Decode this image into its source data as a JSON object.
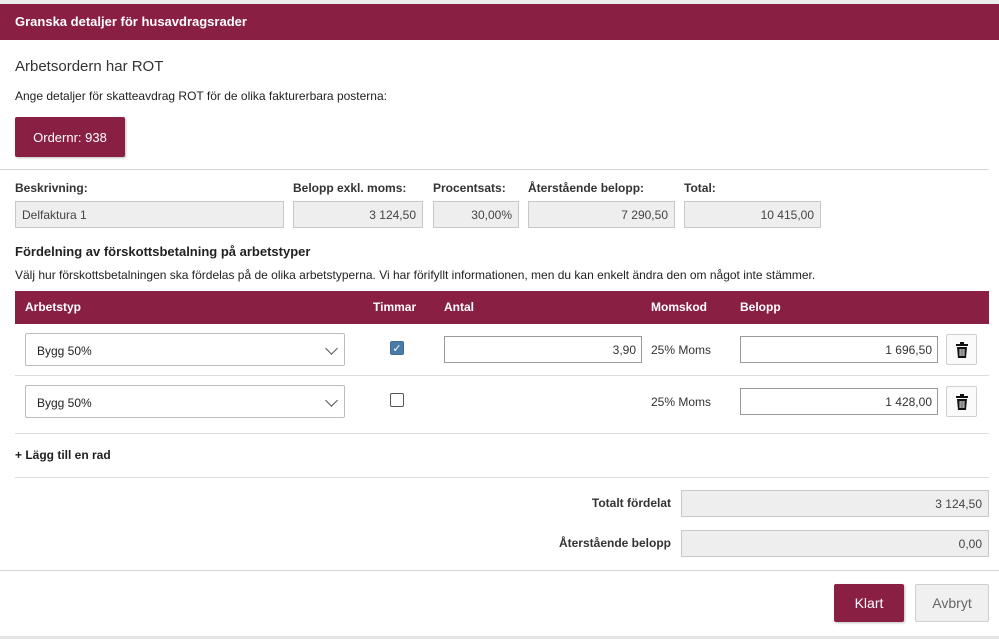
{
  "dialog": {
    "title": "Granska detaljer för husavdragsrader",
    "heading": "Arbetsordern har ROT",
    "instruction": "Ange detaljer för skatteavdrag ROT för de olika fakturerbara posterna:",
    "order_button": "Ordernr: 938"
  },
  "summary": {
    "labels": {
      "description": "Beskrivning:",
      "amount_excl_vat": "Belopp exkl. moms:",
      "percentage": "Procentsats:",
      "remaining": "Återstående belopp:",
      "total": "Total:"
    },
    "values": {
      "description": "Delfaktura 1",
      "amount_excl_vat": "3 124,50",
      "percentage": "30,00%",
      "remaining": "7 290,50",
      "total": "10 415,00"
    }
  },
  "distribution": {
    "title": "Fördelning av förskottsbetalning på arbetstyper",
    "description": "Välj hur förskottsbetalningen ska fördelas på de olika arbetstyperna. Vi har förifyllt informationen, men du kan enkelt ändra den om något inte stämmer.",
    "columns": {
      "work_type": "Arbetstyp",
      "hours": "Timmar",
      "quantity": "Antal",
      "vat_code": "Momskod",
      "amount": "Belopp"
    },
    "rows": [
      {
        "work_type": "Bygg 50%",
        "hours_checked": true,
        "hours_mark": "✓",
        "quantity": "3,90",
        "vat_code": "25% Moms",
        "amount": "1 696,50"
      },
      {
        "work_type": "Bygg 50%",
        "hours_checked": false,
        "hours_mark": "",
        "quantity": "",
        "vat_code": "25% Moms",
        "amount": "1 428,00"
      }
    ],
    "add_row": "+ Lägg till en rad"
  },
  "totals": {
    "distributed_label": "Totalt fördelat",
    "distributed_value": "3 124,50",
    "remaining_label": "Återstående belopp",
    "remaining_value": "0,00"
  },
  "actions": {
    "ok": "Klart",
    "cancel": "Avbryt"
  },
  "colors": {
    "brand": "#8a1f44",
    "checkbox": "#4a7ba6"
  },
  "icons": {
    "delete": "trash-icon",
    "dropdown": "chevron-down-icon",
    "checked": "checkmark-icon"
  }
}
